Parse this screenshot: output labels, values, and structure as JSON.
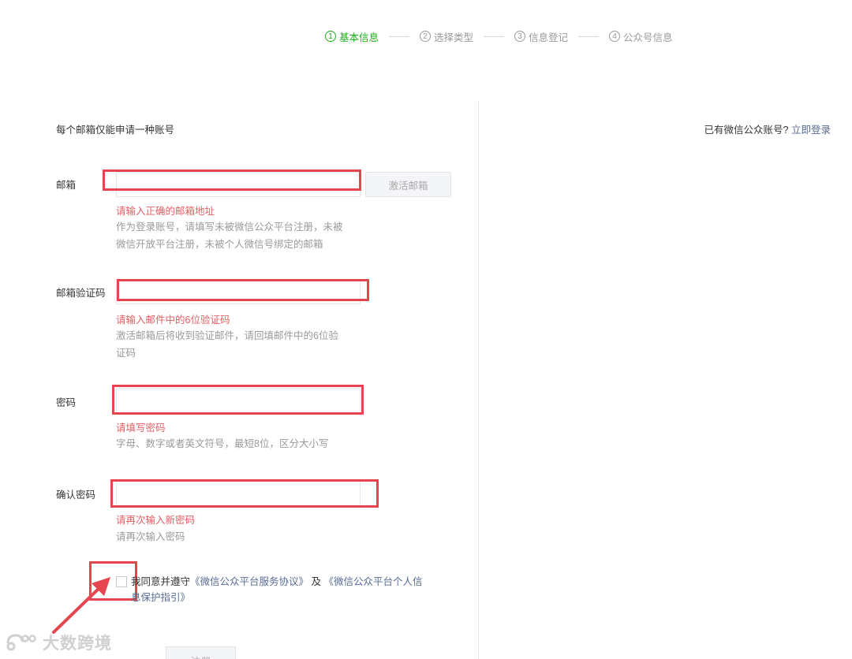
{
  "steps": [
    {
      "num": "1",
      "label": "基本信息",
      "active": true
    },
    {
      "num": "2",
      "label": "选择类型",
      "active": false
    },
    {
      "num": "3",
      "label": "信息登记",
      "active": false
    },
    {
      "num": "4",
      "label": "公众号信息",
      "active": false
    }
  ],
  "notice": "每个邮箱仅能申请一种账号",
  "login_tip": {
    "text": "已有微信公众账号?",
    "link": "立即登录"
  },
  "fields": {
    "email": {
      "label": "邮箱",
      "value": "",
      "error": "请输入正确的邮箱地址",
      "tip": "作为登录账号，请填写未被微信公众平台注册，未被微信开放平台注册，未被个人微信号绑定的邮箱",
      "activate_button": "激活邮箱"
    },
    "code": {
      "label": "邮箱验证码",
      "value": "",
      "error": "请输入邮件中的6位验证码",
      "tip": "激活邮箱后将收到验证邮件，请回填邮件中的6位验证码"
    },
    "password": {
      "label": "密码",
      "value": "",
      "error": "请填写密码",
      "tip": "字母、数字或者英文符号，最短8位，区分大小写"
    },
    "confirm": {
      "label": "确认密码",
      "value": "",
      "error": "请再次输入新密码",
      "tip": "请再次输入密码"
    }
  },
  "agreement": {
    "prefix": "我同意并遵守",
    "link1": "《微信公众平台服务协议》",
    "middle": " 及 ",
    "link2": "《微信公众平台个人信息保护指引》",
    "checked": false
  },
  "register_button": "注册",
  "watermark": "大数跨境",
  "colors": {
    "accent": "#1aad19",
    "error": "#e15f63",
    "highlight": "#e5454f",
    "link": "#576b95"
  }
}
